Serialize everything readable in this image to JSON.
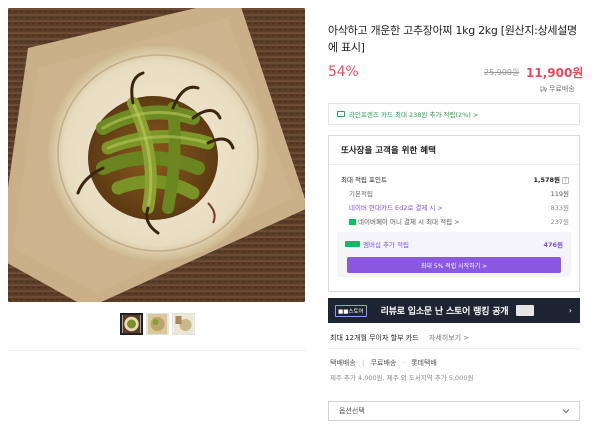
{
  "product": {
    "title": "아삭하고 개운한 고추장아찌 1kg 2kg [원산지:상세설명에 표시]",
    "discount": "54%",
    "original_price": "25,900원",
    "sale_price": "11,900원",
    "shipping": "무료배송"
  },
  "card_promo": "라인프렌즈 카드 최대 238원 추가 적립(2%) >",
  "benefits": {
    "title": "또사장을 고객을 위한 혜택",
    "max_points_label": "최대 적립 포인트",
    "max_points_value": "1,578원",
    "q_mark": "?",
    "basic_label": "기본적립",
    "basic_value": "119원",
    "hyundai_label": "네이버 현대카드 Ed2로 결제 시 >",
    "hyundai_value": "833원",
    "npay_label": "네이버페이 머니 결제 시 최대 적립 >",
    "npay_value": "237원",
    "membership_label": "멤버십 추가 적립",
    "membership_value": "476원",
    "membership_button": "최대 5% 적립 시작하기 >"
  },
  "banner": {
    "logo": "■■스토어",
    "text": "리뷰로 입소문 난 스토어 랭킹 공개",
    "arrow": "›"
  },
  "installment": {
    "text": "최대 12개월 무이자 할부 카드",
    "link": "자세히보기 >"
  },
  "delivery": {
    "type": "택배배송",
    "fee": "무료배송",
    "courier": "롯데택배",
    "extra": "제주 추가 4,000원, 제주 외 도서지역 추가 5,000원"
  },
  "option": {
    "placeholder": "옵션선택"
  },
  "thumbnails": [
    "pickled-pepper-thumb-1",
    "pickled-pepper-thumb-2",
    "pickled-pepper-thumb-3"
  ]
}
